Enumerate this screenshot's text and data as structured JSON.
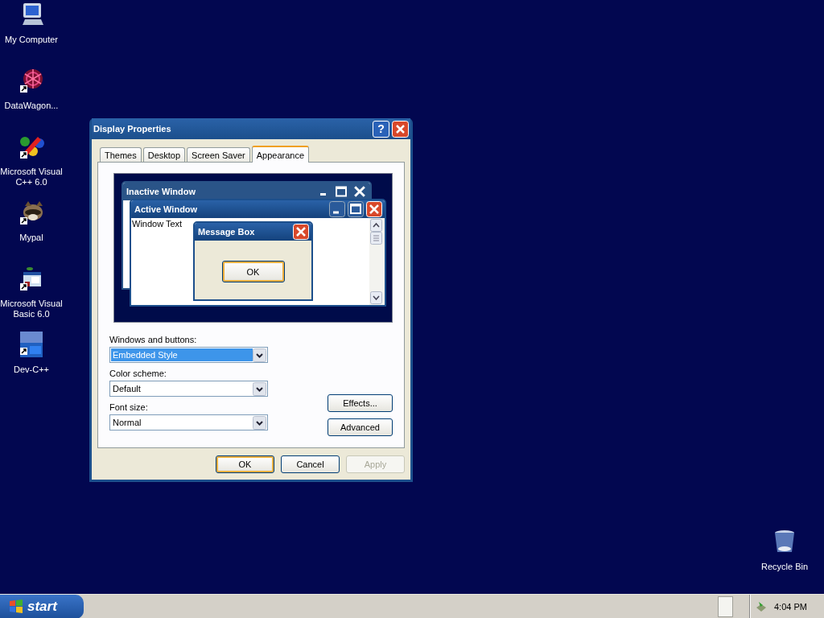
{
  "desktop": {
    "icons": [
      {
        "label": "My Computer",
        "kind": "computer"
      },
      {
        "label": "DataWagon...",
        "kind": "web"
      },
      {
        "label": "Microsoft Visual C++ 6.0",
        "kind": "cpp"
      },
      {
        "label": "Mypal",
        "kind": "raccoon"
      },
      {
        "label": "Microsoft Visual Basic 6.0",
        "kind": "vb"
      },
      {
        "label": "Dev-C++",
        "kind": "dev"
      }
    ],
    "recycle_bin": {
      "label": "Recycle Bin"
    }
  },
  "dialog": {
    "title": "Display Properties",
    "help_button": "?",
    "tabs": [
      {
        "label": "Themes",
        "selected": false
      },
      {
        "label": "Desktop",
        "selected": false
      },
      {
        "label": "Screen Saver",
        "selected": false
      },
      {
        "label": "Appearance",
        "selected": true
      }
    ],
    "preview": {
      "inactive_title": "Inactive Window",
      "active_title": "Active Window",
      "window_text": "Window Text",
      "message_box_title": "Message Box",
      "message_box_button": "OK"
    },
    "fields": [
      {
        "label": "Windows and buttons:",
        "value": "Embedded Style",
        "selected": true
      },
      {
        "label": "Color scheme:",
        "value": "Default",
        "selected": false
      },
      {
        "label": "Font size:",
        "value": "Normal",
        "selected": false
      }
    ],
    "side_buttons": [
      "Effects...",
      "Advanced"
    ],
    "buttons": [
      {
        "label": "OK",
        "default": true,
        "disabled": false
      },
      {
        "label": "Cancel",
        "default": false,
        "disabled": false
      },
      {
        "label": "Apply",
        "default": false,
        "disabled": true
      }
    ]
  },
  "taskbar": {
    "start": "start",
    "clock": "4:04 PM"
  }
}
